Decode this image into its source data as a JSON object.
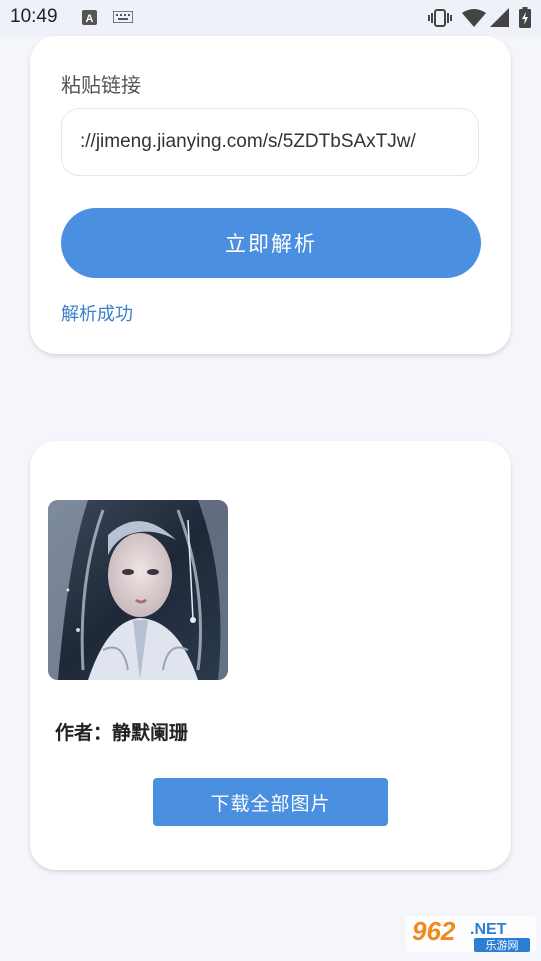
{
  "status_bar": {
    "time": "10:49",
    "icons": [
      "a-keyboard-icon",
      "keyboard-icon",
      "vibrate-icon",
      "wifi-icon",
      "signal-icon",
      "battery-icon"
    ]
  },
  "parse_card": {
    "label": "粘贴链接",
    "url_value": "://jimeng.jianying.com/s/5ZDTbSAxTJw/",
    "parse_button": "立即解析",
    "status": "解析成功"
  },
  "result_card": {
    "author": "作者：静默阑珊",
    "download_button": "下载全部图片"
  },
  "watermark": {
    "brand": "962",
    "net": ".NET",
    "site": "乐游网"
  },
  "colors": {
    "accent": "#4a8fe0",
    "status_text": "#3c7fcb",
    "page_bg": "#f4f6fb"
  }
}
